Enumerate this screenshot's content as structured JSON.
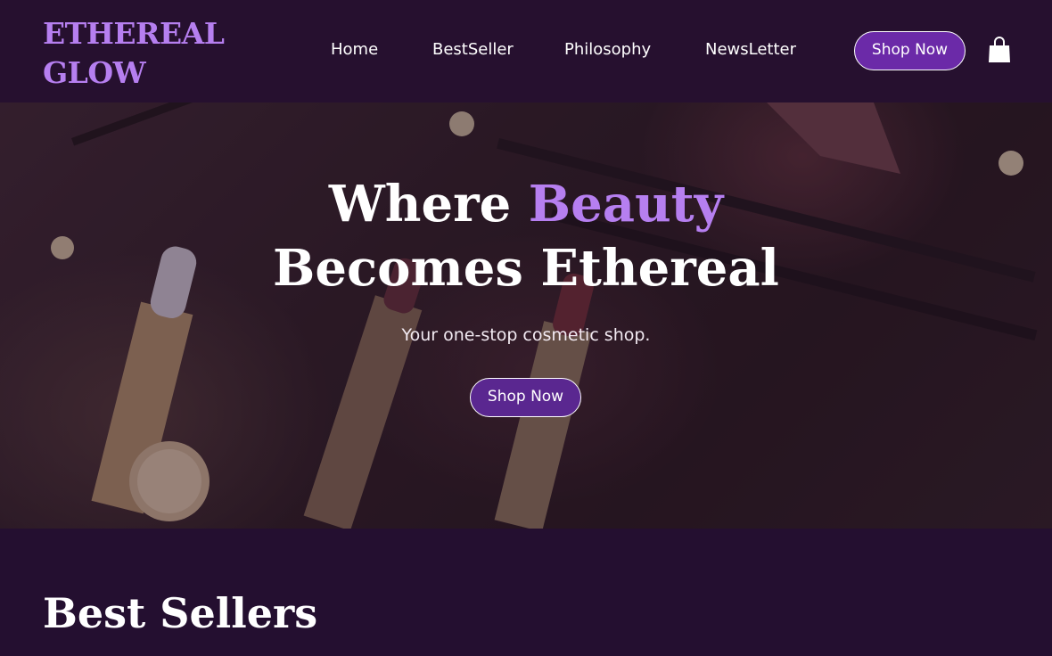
{
  "header": {
    "logo_line1": "ETHEREAL",
    "logo_line2": "GLOW",
    "nav": [
      "Home",
      "BestSeller",
      "Philosophy",
      "NewsLetter"
    ],
    "shop_button": "Shop Now",
    "cart_icon": "shopping-bag-icon"
  },
  "hero": {
    "title_part1": "Where ",
    "title_accent": "Beauty",
    "title_line2": "Becomes Ethereal",
    "subtitle": "Your one-stop cosmetic shop.",
    "button": "Shop Now"
  },
  "best_sellers": {
    "title": "Best Sellers"
  },
  "colors": {
    "background": "#240f30",
    "accent": "#b67ff0",
    "button": "#6b2aa8"
  }
}
